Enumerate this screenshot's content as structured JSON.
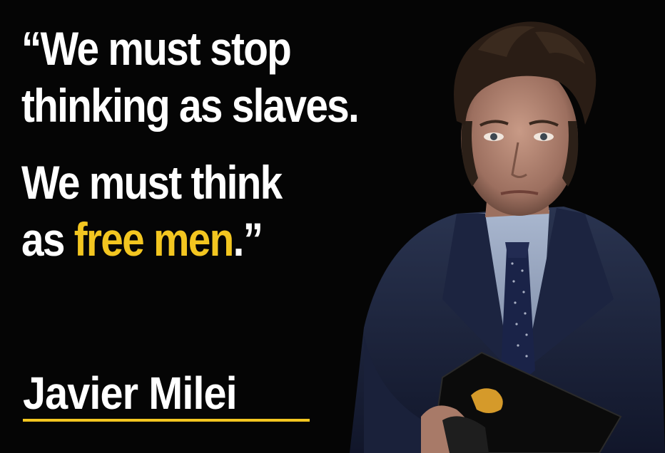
{
  "quote": {
    "line1": "“We must stop",
    "line2": "thinking as slaves.",
    "line3": "We must think",
    "line4_prefix": "as ",
    "line4_highlight": "free men",
    "line4_suffix": ".”"
  },
  "author": "Javier Milei",
  "colors": {
    "background": "#050505",
    "text": "#ffffff",
    "accent": "#f3c620"
  }
}
